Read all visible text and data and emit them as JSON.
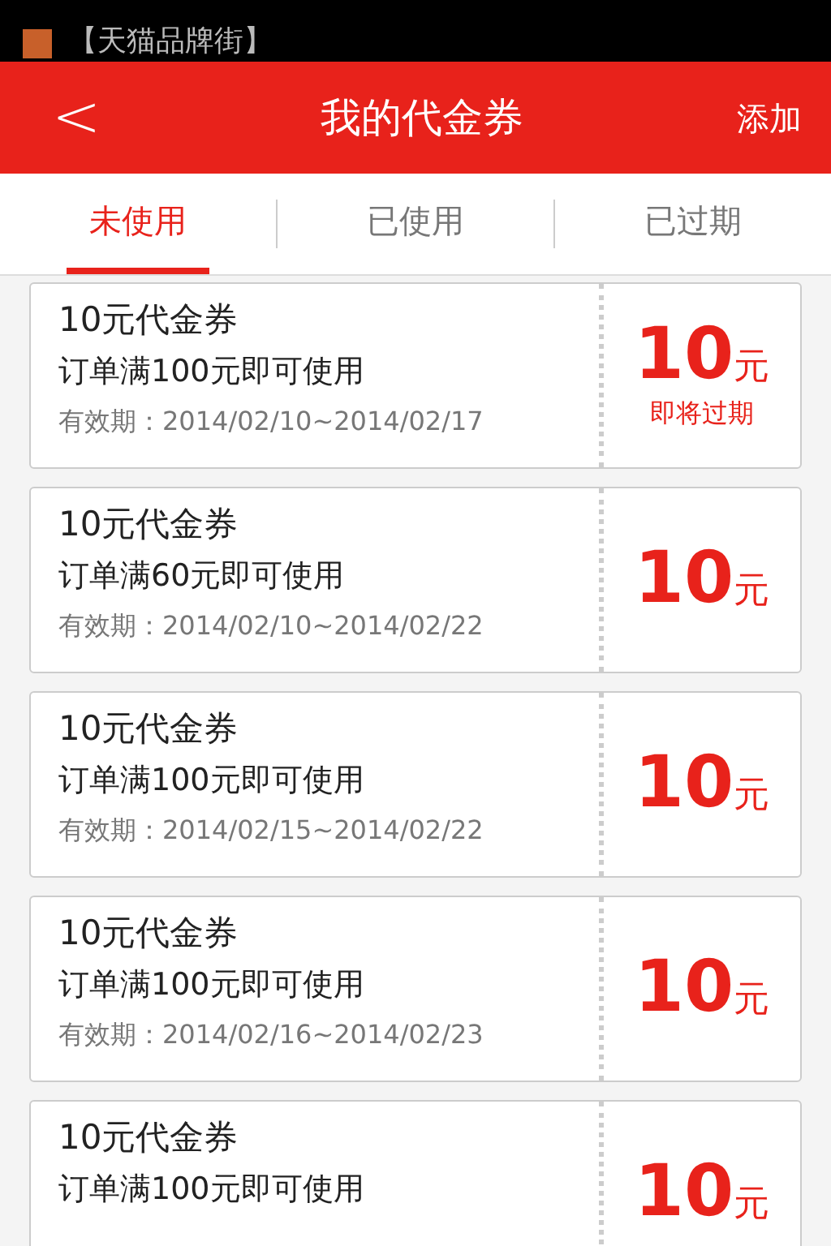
{
  "notification": {
    "text": "【天猫品牌街】"
  },
  "header": {
    "back": "<",
    "title": "我的代金券",
    "action": "添加"
  },
  "tabs": [
    {
      "label": "未使用",
      "selected": true
    },
    {
      "label": "已使用",
      "selected": false
    },
    {
      "label": "已过期",
      "selected": false
    }
  ],
  "coupons": [
    {
      "title": "10元代金券",
      "condition": "订单满100元即可使用",
      "validity": "有效期：2014/02/10~2014/02/17",
      "amount": "10",
      "unit": "元",
      "note": "即将过期"
    },
    {
      "title": "10元代金券",
      "condition": "订单满60元即可使用",
      "validity": "有效期：2014/02/10~2014/02/22",
      "amount": "10",
      "unit": "元"
    },
    {
      "title": "10元代金券",
      "condition": "订单满100元即可使用",
      "validity": "有效期：2014/02/15~2014/02/22",
      "amount": "10",
      "unit": "元"
    },
    {
      "title": "10元代金券",
      "condition": "订单满100元即可使用",
      "validity": "有效期：2014/02/16~2014/02/23",
      "amount": "10",
      "unit": "元"
    },
    {
      "title": "10元代金券",
      "condition": "订单满100元即可使用",
      "amount": "10",
      "unit": "元"
    }
  ]
}
